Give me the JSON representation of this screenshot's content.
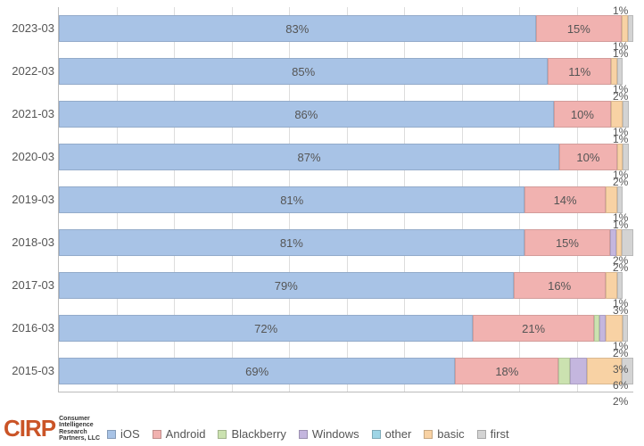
{
  "chart_data": {
    "type": "bar",
    "orientation": "horizontal",
    "stacked": true,
    "categories": [
      "2023-03",
      "2022-03",
      "2021-03",
      "2020-03",
      "2019-03",
      "2018-03",
      "2017-03",
      "2016-03",
      "2015-03"
    ],
    "series": [
      {
        "name": "iOS",
        "color": "#A8C3E6",
        "values": [
          83,
          85,
          86,
          87,
          81,
          81,
          79,
          72,
          69
        ]
      },
      {
        "name": "Android",
        "color": "#F1B2B0",
        "values": [
          15,
          11,
          10,
          10,
          14,
          15,
          16,
          21,
          18
        ]
      },
      {
        "name": "Blackberry",
        "color": "#CBE2B0",
        "values": [
          0,
          0,
          0,
          0,
          0,
          0,
          0,
          1,
          2
        ]
      },
      {
        "name": "Windows",
        "color": "#C4B6DE",
        "values": [
          0,
          0,
          0,
          0,
          0,
          1,
          0,
          1,
          3
        ]
      },
      {
        "name": "other",
        "color": "#9ED5E6",
        "values": [
          0,
          0,
          0,
          0,
          0,
          0,
          0,
          0,
          0
        ]
      },
      {
        "name": "basic",
        "color": "#F8D2A4",
        "values": [
          1,
          1,
          2,
          1,
          2,
          1,
          2,
          3,
          6
        ]
      },
      {
        "name": "first",
        "color": "#D3D3D3",
        "values": [
          1,
          1,
          1,
          1,
          1,
          2,
          1,
          1,
          2
        ]
      }
    ],
    "visible_labels": {
      "2023-03": {
        "iOS": "83%",
        "Android": "15%",
        "basic": "1%",
        "first": "1%"
      },
      "2022-03": {
        "iOS": "85%",
        "Android": "11%",
        "basic": "1%",
        "first": "1%"
      },
      "2021-03": {
        "iOS": "86%",
        "Android": "10%",
        "basic": "2%",
        "first": "1%"
      },
      "2020-03": {
        "iOS": "87%",
        "Android": "10%",
        "basic": "1%",
        "first": "1%"
      },
      "2019-03": {
        "iOS": "81%",
        "Android": "14%",
        "basic": "2%",
        "first": "1%"
      },
      "2018-03": {
        "iOS": "81%",
        "Android": "15%",
        "Windows": "1%",
        "first": "2%"
      },
      "2017-03": {
        "iOS": "79%",
        "Android": "16%",
        "basic": "2%",
        "first": "1%"
      },
      "2016-03": {
        "iOS": "72%",
        "Android": "21%",
        "basic": "3%",
        "first": "1%"
      },
      "2015-03": {
        "iOS": "69%",
        "Android": "18%",
        "Blackberry": "2%",
        "Windows": "3%",
        "basic": "6%",
        "first": "2%"
      }
    },
    "x_range": [
      0,
      100
    ],
    "legend_position": "bottom"
  },
  "attribution": {
    "logo": "CIRP",
    "subtitle": "Consumer\nIntelligence\nResearch\nPartners, LLC"
  }
}
